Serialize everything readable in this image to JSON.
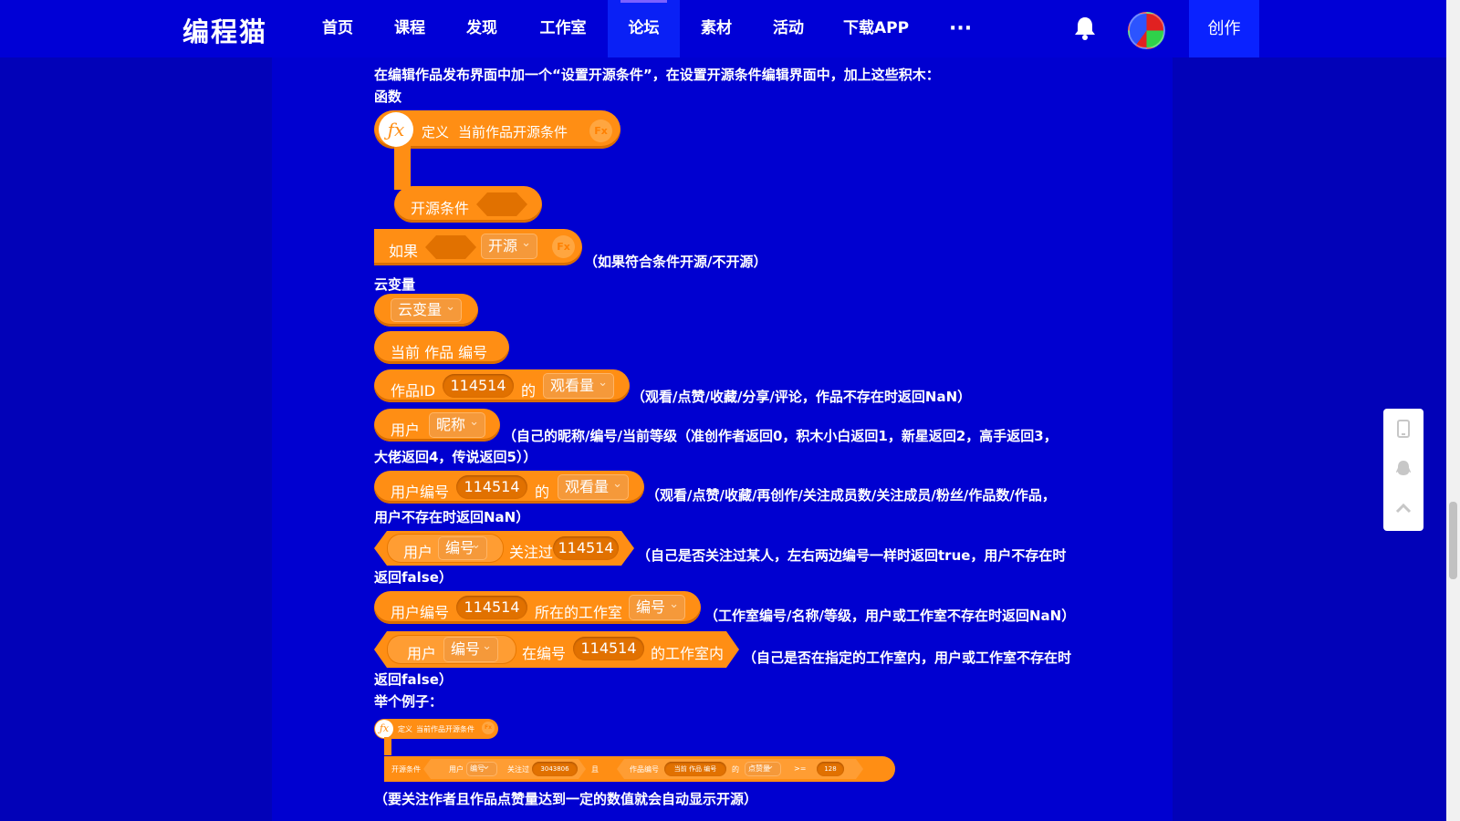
{
  "header": {
    "logo": "编程猫",
    "nav": [
      "首页",
      "课程",
      "发现",
      "工作室",
      "论坛",
      "素材",
      "活动",
      "下载APP"
    ],
    "active_nav": "论坛",
    "more": "···",
    "create_label": "创作"
  },
  "content": {
    "intro": "在编辑作品发布界面中加一个“设置开源条件”，在设置开源条件编辑界面中，加上这些积木：",
    "section_function": "函数",
    "define_block": {
      "define": "定义",
      "name": "当前作品开源条件",
      "fx": "Fx"
    },
    "open_condition_block": {
      "label": "开源条件"
    },
    "if_block": {
      "if": "如果",
      "dropdown": "开源",
      "fx": "Fx"
    },
    "if_note": "（如果符合条件开源/不开源）",
    "section_cloud": "云变量",
    "cloud_var_block": {
      "dropdown": "云变量"
    },
    "current_work_block": {
      "label": "当前 作品 编号"
    },
    "work_id_block": {
      "label": "作品ID",
      "value": "114514",
      "of": "的",
      "dropdown": "观看量"
    },
    "work_id_note": "（观看/点赞/收藏/分享/评论，作品不存在时返回NaN）",
    "user_block": {
      "label": "用户",
      "dropdown": "昵称"
    },
    "user_note_1": "（自己的昵称/编号/当前等级（准创作者返回0，积木小白返回1，新星返回2，高手返回3，",
    "user_note_2": "大佬返回4，传说返回5））",
    "user_id_block": {
      "label": "用户编号",
      "value": "114514",
      "of": "的",
      "dropdown": "观看量"
    },
    "user_id_note_1": "（观看/点赞/收藏/再创作/关注成员数/关注成员/粉丝/作品数/作品，",
    "user_id_note_2": "用户不存在时返回NaN）",
    "follow_block": {
      "user": "用户",
      "dropdown": "编号",
      "followed": "关注过",
      "value": "114514"
    },
    "follow_note_1": "（自己是否关注过某人，左右两边编号一样时返回true，用户不存在时",
    "follow_note_2": "返回false）",
    "studio_block": {
      "label": "用户编号",
      "value": "114514",
      "in_studio": "所在的工作室",
      "dropdown": "编号"
    },
    "studio_note": "（工作室编号/名称/等级，用户或工作室不存在时返回NaN）",
    "in_studio_block": {
      "user": "用户",
      "dropdown": "编号",
      "at": "在编号",
      "value": "114514",
      "studio": "的工作室内"
    },
    "in_studio_note_1": "（自己是否在指定的工作室内，用户或工作室不存在时",
    "in_studio_note_2": "返回false）",
    "example_title": "举个例子：",
    "example": {
      "define": "定义",
      "name": "当前作品开源条件",
      "fx": "Fx",
      "open_condition": "开源条件",
      "user": "用户",
      "user_dd": "编号",
      "followed": "关注过",
      "user_value": "3043806",
      "and": "且",
      "work_id": "作品编号",
      "current_work": "当前 作品 编号",
      "of": "的",
      "stat_dd": "点赞量",
      "op": ">=",
      "threshold": "128"
    },
    "example_note": "（要关注作者且作品点赞量达到一定的数值就会自动显示开源）"
  },
  "colors": {
    "background": "#0202b8",
    "header": "#0000d6",
    "block": "#ff8e14",
    "accent": "#0a22ff"
  }
}
